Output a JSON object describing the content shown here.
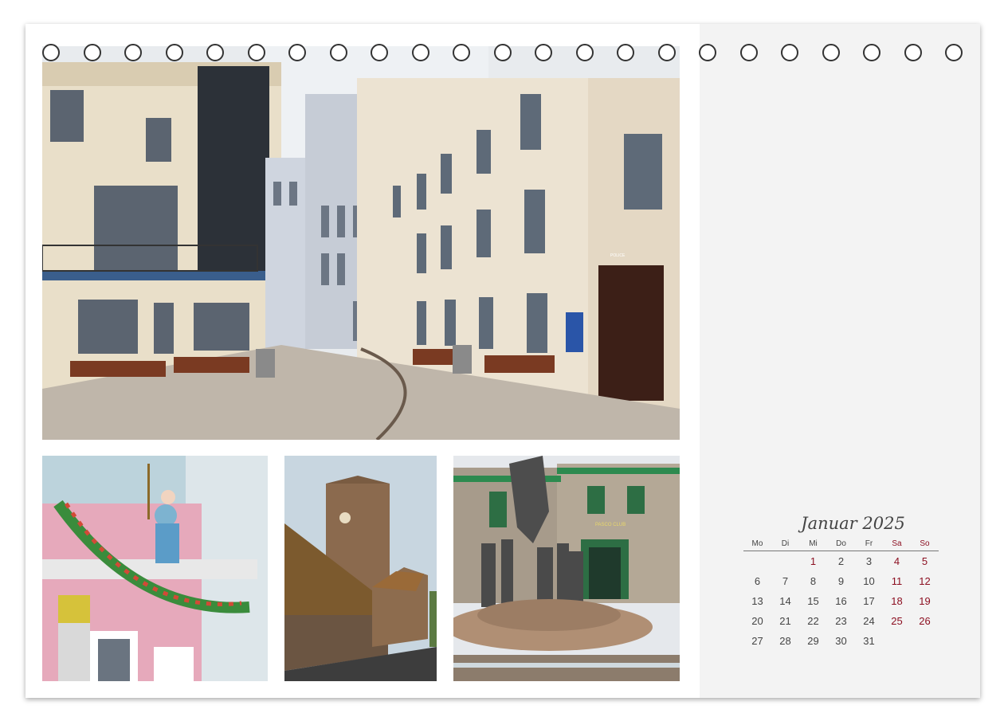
{
  "calendar": {
    "title": "Januar 2025",
    "weekdays": [
      "Mo",
      "Di",
      "Mi",
      "Do",
      "Fr",
      "Sa",
      "So"
    ],
    "weeks": [
      [
        "",
        "",
        "1",
        "2",
        "3",
        "4",
        "5"
      ],
      [
        "6",
        "7",
        "8",
        "9",
        "10",
        "11",
        "12"
      ],
      [
        "13",
        "14",
        "15",
        "16",
        "17",
        "18",
        "19"
      ],
      [
        "20",
        "21",
        "22",
        "23",
        "24",
        "25",
        "26"
      ],
      [
        "27",
        "28",
        "29",
        "30",
        "31",
        "",
        ""
      ]
    ],
    "red_days": [
      "1",
      "4",
      "5",
      "11",
      "12",
      "18",
      "19",
      "25",
      "26"
    ]
  },
  "photos": {
    "street": {
      "sign": "POLICE"
    },
    "fountain": {
      "sign": "PASCO CLUB"
    }
  },
  "colors": {
    "holiday_red": "#8b0d1f",
    "ring": "#333333",
    "panel": "#f3f3f3"
  }
}
